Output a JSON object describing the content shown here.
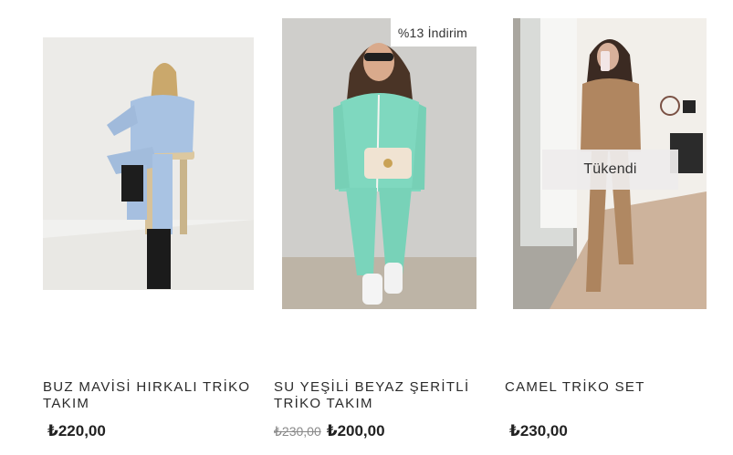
{
  "products": [
    {
      "title": "BUZ MAVİSİ HIRKALI TRİKO TAKIM",
      "price": "₺220,00",
      "image_alt": "Buz mavisi hırkalı triko takım",
      "accent": "#a9c3e3"
    },
    {
      "title": "SU YEŞİLİ BEYAZ ŞERİTLİ TRİKO TAKIM",
      "old_price": "₺230,00",
      "price": "₺200,00",
      "badge": "%13 İndirim",
      "image_alt": "Su yeşili beyaz şeritli triko takım",
      "accent": "#7fd8bf"
    },
    {
      "title": "CAMEL TRİKO SET",
      "price": "₺230,00",
      "status": "Tükendi",
      "image_alt": "Camel triko set",
      "accent": "#b08660"
    }
  ]
}
